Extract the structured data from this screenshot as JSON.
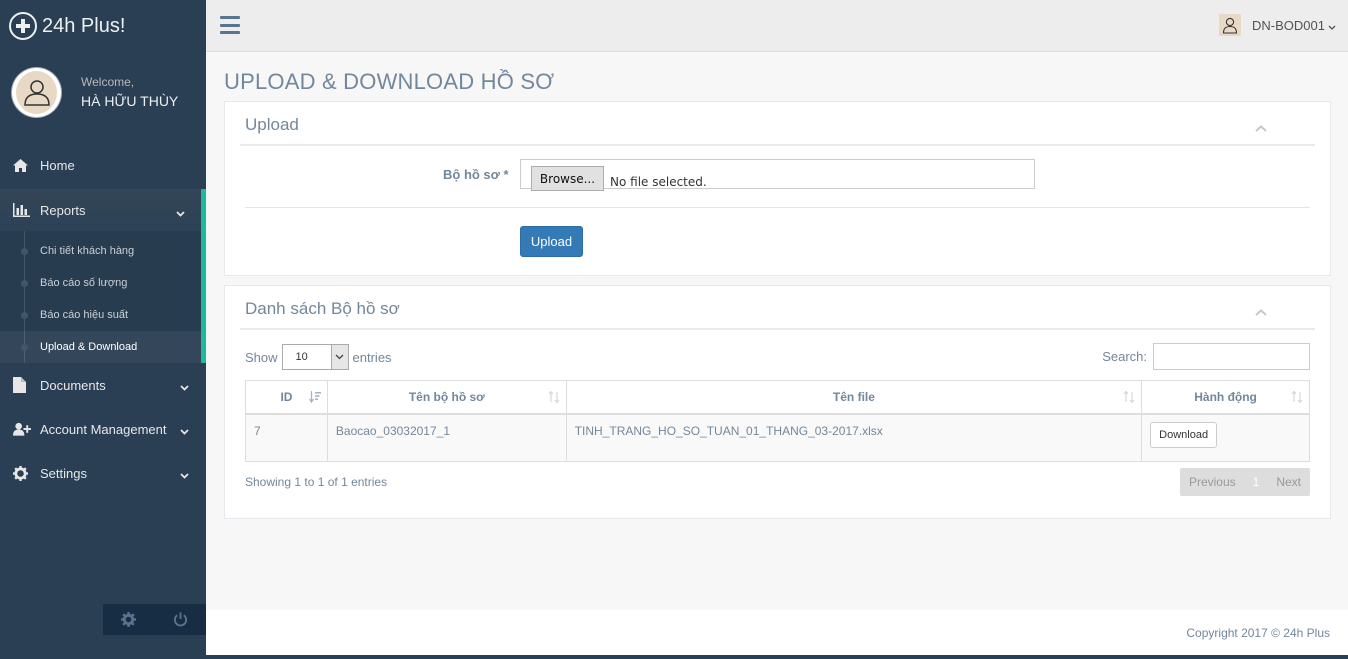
{
  "brand": {
    "name": "24h Plus!"
  },
  "profile": {
    "welcome": "Welcome,",
    "name": "HÀ HỮU THÙY"
  },
  "sidebar": {
    "items": [
      {
        "label": "Home",
        "icon": "home-icon"
      },
      {
        "label": "Reports",
        "icon": "bar-chart-icon"
      },
      {
        "label": "Documents",
        "icon": "file-icon"
      },
      {
        "label": "Account Management",
        "icon": "user-plus-icon"
      },
      {
        "label": "Settings",
        "icon": "gear-icon"
      }
    ],
    "reports_sub": [
      {
        "label": "Chi tiết khách hàng"
      },
      {
        "label": "Báo cáo số lượng"
      },
      {
        "label": "Báo cáo hiệu suất"
      },
      {
        "label": "Upload & Download"
      }
    ]
  },
  "topnav": {
    "user": "DN-BOD001"
  },
  "page": {
    "title": "UPLOAD & DOWNLOAD HỒ SƠ"
  },
  "upload_panel": {
    "title": "Upload",
    "field_label": "Bộ hồ sơ *",
    "browse_label": "Browse...",
    "file_status": "No file selected.",
    "upload_label": "Upload"
  },
  "list_panel": {
    "title": "Danh sách Bộ hồ sơ",
    "show_label": "Show",
    "entries_value": "10",
    "entries_label": "entries",
    "search_label": "Search:",
    "search_value": "",
    "columns": [
      "ID",
      "Tên bộ hồ sơ",
      "Tên file",
      "Hành động"
    ],
    "rows": [
      {
        "id": "7",
        "name": "Baocao_03032017_1",
        "file": "TINH_TRANG_HO_SO_TUAN_01_THANG_03-2017.xlsx",
        "action": "Download"
      }
    ],
    "info": "Showing 1 to 1 of 1 entries",
    "pager": {
      "previous": "Previous",
      "page": "1",
      "next": "Next"
    }
  },
  "footer": {
    "copyright": "Copyright 2017 © 24h Plus"
  },
  "colors": {
    "sidebar": "#2A3F54",
    "accent": "#1ABB9C",
    "primary": "#337AB7",
    "text": "#73879C"
  }
}
